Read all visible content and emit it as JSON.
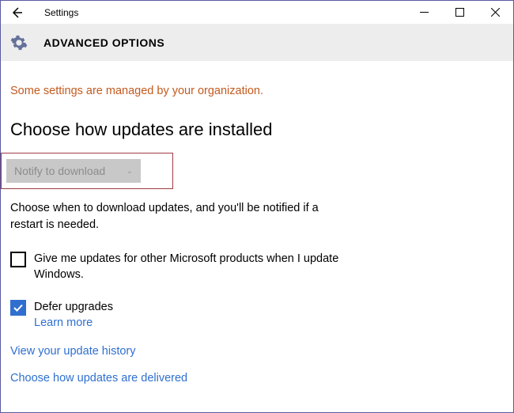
{
  "titlebar": {
    "app_title": "Settings"
  },
  "header": {
    "page_title": "ADVANCED OPTIONS"
  },
  "notice": "Some settings are managed by your organization.",
  "section_heading": "Choose how updates are installed",
  "dropdown": {
    "selected": "Notify to download"
  },
  "body_text": "Choose when to download updates, and you'll be notified if a restart is needed.",
  "checkbox1": {
    "checked": false,
    "label": "Give me updates for other Microsoft products when I update Windows."
  },
  "checkbox2": {
    "checked": true,
    "label": "Defer upgrades",
    "learn_more": "Learn more"
  },
  "links": {
    "history": "View your update history",
    "delivered": "Choose how updates are delivered"
  }
}
